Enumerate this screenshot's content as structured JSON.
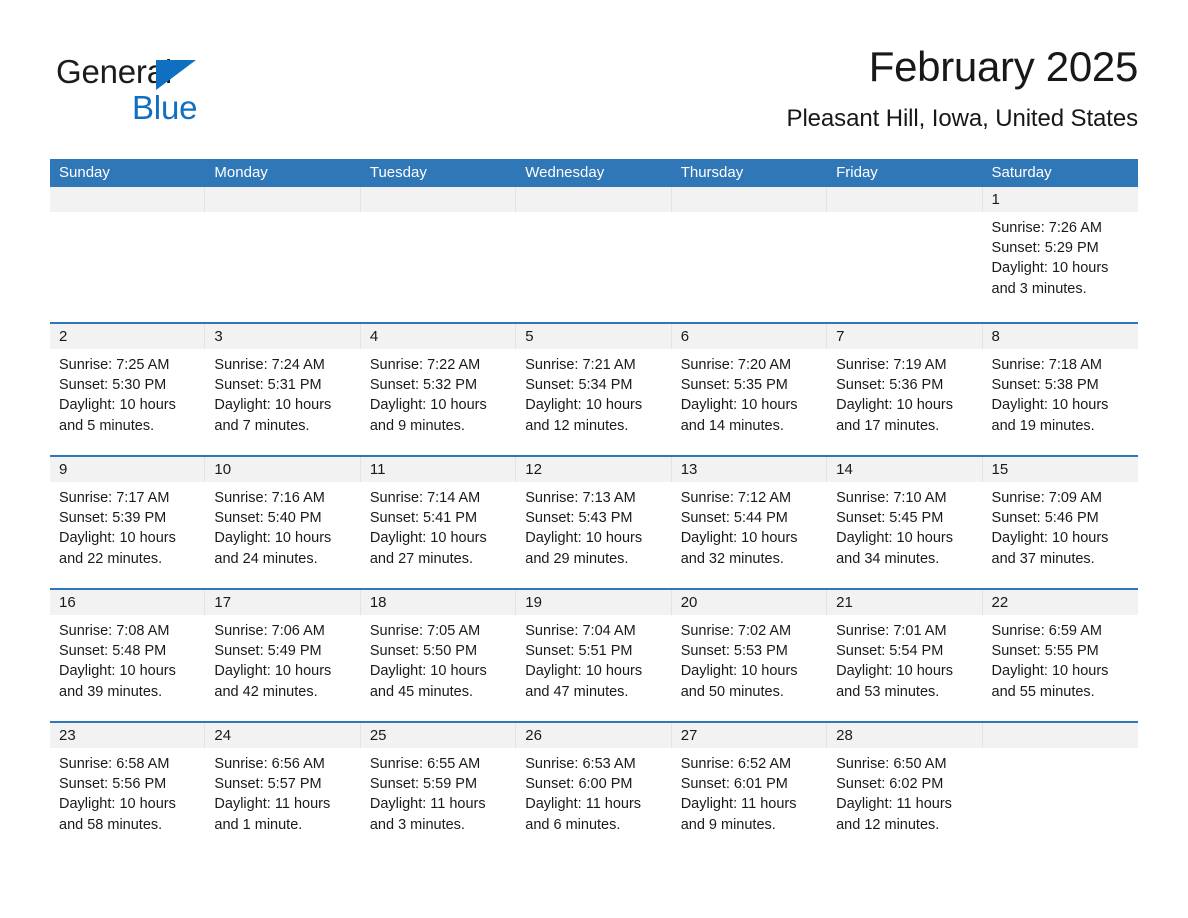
{
  "brand": {
    "name_part1": "General",
    "name_part2": "Blue",
    "accent_color": "#0f6fc0"
  },
  "header": {
    "month_title": "February 2025",
    "location": "Pleasant Hill, Iowa, United States"
  },
  "calendar": {
    "header_color": "#3077b8",
    "daynum_strip_color": "#f2f2f2",
    "weekdays": [
      "Sunday",
      "Monday",
      "Tuesday",
      "Wednesday",
      "Thursday",
      "Friday",
      "Saturday"
    ],
    "weeks": [
      [
        {
          "day": ""
        },
        {
          "day": ""
        },
        {
          "day": ""
        },
        {
          "day": ""
        },
        {
          "day": ""
        },
        {
          "day": ""
        },
        {
          "day": "1",
          "sunrise": "Sunrise: 7:26 AM",
          "sunset": "Sunset: 5:29 PM",
          "daylight": "Daylight: 10 hours and 3 minutes."
        }
      ],
      [
        {
          "day": "2",
          "sunrise": "Sunrise: 7:25 AM",
          "sunset": "Sunset: 5:30 PM",
          "daylight": "Daylight: 10 hours and 5 minutes."
        },
        {
          "day": "3",
          "sunrise": "Sunrise: 7:24 AM",
          "sunset": "Sunset: 5:31 PM",
          "daylight": "Daylight: 10 hours and 7 minutes."
        },
        {
          "day": "4",
          "sunrise": "Sunrise: 7:22 AM",
          "sunset": "Sunset: 5:32 PM",
          "daylight": "Daylight: 10 hours and 9 minutes."
        },
        {
          "day": "5",
          "sunrise": "Sunrise: 7:21 AM",
          "sunset": "Sunset: 5:34 PM",
          "daylight": "Daylight: 10 hours and 12 minutes."
        },
        {
          "day": "6",
          "sunrise": "Sunrise: 7:20 AM",
          "sunset": "Sunset: 5:35 PM",
          "daylight": "Daylight: 10 hours and 14 minutes."
        },
        {
          "day": "7",
          "sunrise": "Sunrise: 7:19 AM",
          "sunset": "Sunset: 5:36 PM",
          "daylight": "Daylight: 10 hours and 17 minutes."
        },
        {
          "day": "8",
          "sunrise": "Sunrise: 7:18 AM",
          "sunset": "Sunset: 5:38 PM",
          "daylight": "Daylight: 10 hours and 19 minutes."
        }
      ],
      [
        {
          "day": "9",
          "sunrise": "Sunrise: 7:17 AM",
          "sunset": "Sunset: 5:39 PM",
          "daylight": "Daylight: 10 hours and 22 minutes."
        },
        {
          "day": "10",
          "sunrise": "Sunrise: 7:16 AM",
          "sunset": "Sunset: 5:40 PM",
          "daylight": "Daylight: 10 hours and 24 minutes."
        },
        {
          "day": "11",
          "sunrise": "Sunrise: 7:14 AM",
          "sunset": "Sunset: 5:41 PM",
          "daylight": "Daylight: 10 hours and 27 minutes."
        },
        {
          "day": "12",
          "sunrise": "Sunrise: 7:13 AM",
          "sunset": "Sunset: 5:43 PM",
          "daylight": "Daylight: 10 hours and 29 minutes."
        },
        {
          "day": "13",
          "sunrise": "Sunrise: 7:12 AM",
          "sunset": "Sunset: 5:44 PM",
          "daylight": "Daylight: 10 hours and 32 minutes."
        },
        {
          "day": "14",
          "sunrise": "Sunrise: 7:10 AM",
          "sunset": "Sunset: 5:45 PM",
          "daylight": "Daylight: 10 hours and 34 minutes."
        },
        {
          "day": "15",
          "sunrise": "Sunrise: 7:09 AM",
          "sunset": "Sunset: 5:46 PM",
          "daylight": "Daylight: 10 hours and 37 minutes."
        }
      ],
      [
        {
          "day": "16",
          "sunrise": "Sunrise: 7:08 AM",
          "sunset": "Sunset: 5:48 PM",
          "daylight": "Daylight: 10 hours and 39 minutes."
        },
        {
          "day": "17",
          "sunrise": "Sunrise: 7:06 AM",
          "sunset": "Sunset: 5:49 PM",
          "daylight": "Daylight: 10 hours and 42 minutes."
        },
        {
          "day": "18",
          "sunrise": "Sunrise: 7:05 AM",
          "sunset": "Sunset: 5:50 PM",
          "daylight": "Daylight: 10 hours and 45 minutes."
        },
        {
          "day": "19",
          "sunrise": "Sunrise: 7:04 AM",
          "sunset": "Sunset: 5:51 PM",
          "daylight": "Daylight: 10 hours and 47 minutes."
        },
        {
          "day": "20",
          "sunrise": "Sunrise: 7:02 AM",
          "sunset": "Sunset: 5:53 PM",
          "daylight": "Daylight: 10 hours and 50 minutes."
        },
        {
          "day": "21",
          "sunrise": "Sunrise: 7:01 AM",
          "sunset": "Sunset: 5:54 PM",
          "daylight": "Daylight: 10 hours and 53 minutes."
        },
        {
          "day": "22",
          "sunrise": "Sunrise: 6:59 AM",
          "sunset": "Sunset: 5:55 PM",
          "daylight": "Daylight: 10 hours and 55 minutes."
        }
      ],
      [
        {
          "day": "23",
          "sunrise": "Sunrise: 6:58 AM",
          "sunset": "Sunset: 5:56 PM",
          "daylight": "Daylight: 10 hours and 58 minutes."
        },
        {
          "day": "24",
          "sunrise": "Sunrise: 6:56 AM",
          "sunset": "Sunset: 5:57 PM",
          "daylight": "Daylight: 11 hours and 1 minute."
        },
        {
          "day": "25",
          "sunrise": "Sunrise: 6:55 AM",
          "sunset": "Sunset: 5:59 PM",
          "daylight": "Daylight: 11 hours and 3 minutes."
        },
        {
          "day": "26",
          "sunrise": "Sunrise: 6:53 AM",
          "sunset": "Sunset: 6:00 PM",
          "daylight": "Daylight: 11 hours and 6 minutes."
        },
        {
          "day": "27",
          "sunrise": "Sunrise: 6:52 AM",
          "sunset": "Sunset: 6:01 PM",
          "daylight": "Daylight: 11 hours and 9 minutes."
        },
        {
          "day": "28",
          "sunrise": "Sunrise: 6:50 AM",
          "sunset": "Sunset: 6:02 PM",
          "daylight": "Daylight: 11 hours and 12 minutes."
        },
        {
          "day": ""
        }
      ]
    ]
  }
}
